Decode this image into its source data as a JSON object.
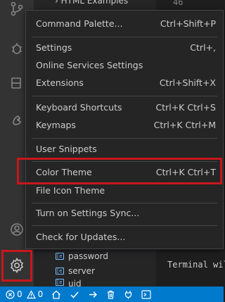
{
  "explorer": {
    "top_item": "HTML Examples",
    "line_number": "46",
    "items": [
      {
        "label": "password"
      },
      {
        "label": "server"
      },
      {
        "label": "uid"
      }
    ]
  },
  "terminal": {
    "text": "Terminal wil"
  },
  "menu": {
    "items": [
      {
        "label": "Command Palette...",
        "shortcut": "Ctrl+Shift+P"
      },
      {
        "label": "Settings",
        "shortcut": "Ctrl+,"
      },
      {
        "label": "Online Services Settings",
        "shortcut": ""
      },
      {
        "label": "Extensions",
        "shortcut": "Ctrl+Shift+X"
      },
      {
        "label": "Keyboard Shortcuts",
        "shortcut": "Ctrl+K Ctrl+S"
      },
      {
        "label": "Keymaps",
        "shortcut": "Ctrl+K Ctrl+M"
      },
      {
        "label": "User Snippets",
        "shortcut": ""
      },
      {
        "label": "Color Theme",
        "shortcut": "Ctrl+K Ctrl+T"
      },
      {
        "label": "File Icon Theme",
        "shortcut": ""
      },
      {
        "label": "Turn on Settings Sync...",
        "shortcut": ""
      },
      {
        "label": "Check for Updates...",
        "shortcut": ""
      }
    ]
  },
  "status_bar": {
    "errors": "0",
    "warnings": "0"
  },
  "colors": {
    "accent": "#007acc",
    "highlight": "#c8161d",
    "menu_bg": "#252526",
    "activity_bar": "#333333"
  }
}
